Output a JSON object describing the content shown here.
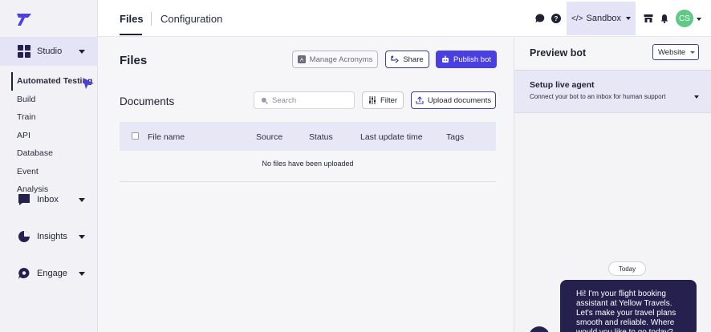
{
  "topbar": {
    "tabs": [
      "Files",
      "Configuration"
    ],
    "environment": "Sandbox",
    "avatar_initials": "CS"
  },
  "sidebar": {
    "groups": [
      {
        "label": "Studio",
        "icon": "grid-icon"
      },
      {
        "label": "Inbox",
        "icon": "chat-bubble-icon"
      },
      {
        "label": "Insights",
        "icon": "pie-chart-icon"
      },
      {
        "label": "Engage",
        "icon": "engage-icon"
      }
    ],
    "studio_items": [
      "Automated Testing",
      "Build",
      "Train",
      "API",
      "Database",
      "Event",
      "Analysis"
    ]
  },
  "main": {
    "title": "Files",
    "buttons": {
      "manage_acronyms": "Manage Acronyms",
      "share": "Share",
      "publish": "Publish bot",
      "filter": "Filter",
      "upload": "Upload documents"
    },
    "section_title": "Documents",
    "search_placeholder": "Search",
    "table": {
      "columns": [
        "File name",
        "Source",
        "Status",
        "Last update time",
        "Tags"
      ],
      "empty_message": "No files have been uploaded"
    }
  },
  "preview": {
    "title": "Preview bot",
    "channel": "Website",
    "live_agent_title": "Setup live agent",
    "live_agent_subtitle": "Connect your bot to an inbox for human support",
    "date_chip": "Today",
    "bot_message": "Hi! I'm your flight booking assistant at Yellow Travels. Let's make your travel plans smooth and reliable. Where would you like to go today?"
  },
  "colors": {
    "accent": "#4a3fe0",
    "highlight": "#e5e4f6",
    "bubble": "#25204e",
    "avatar": "#5fc985"
  }
}
